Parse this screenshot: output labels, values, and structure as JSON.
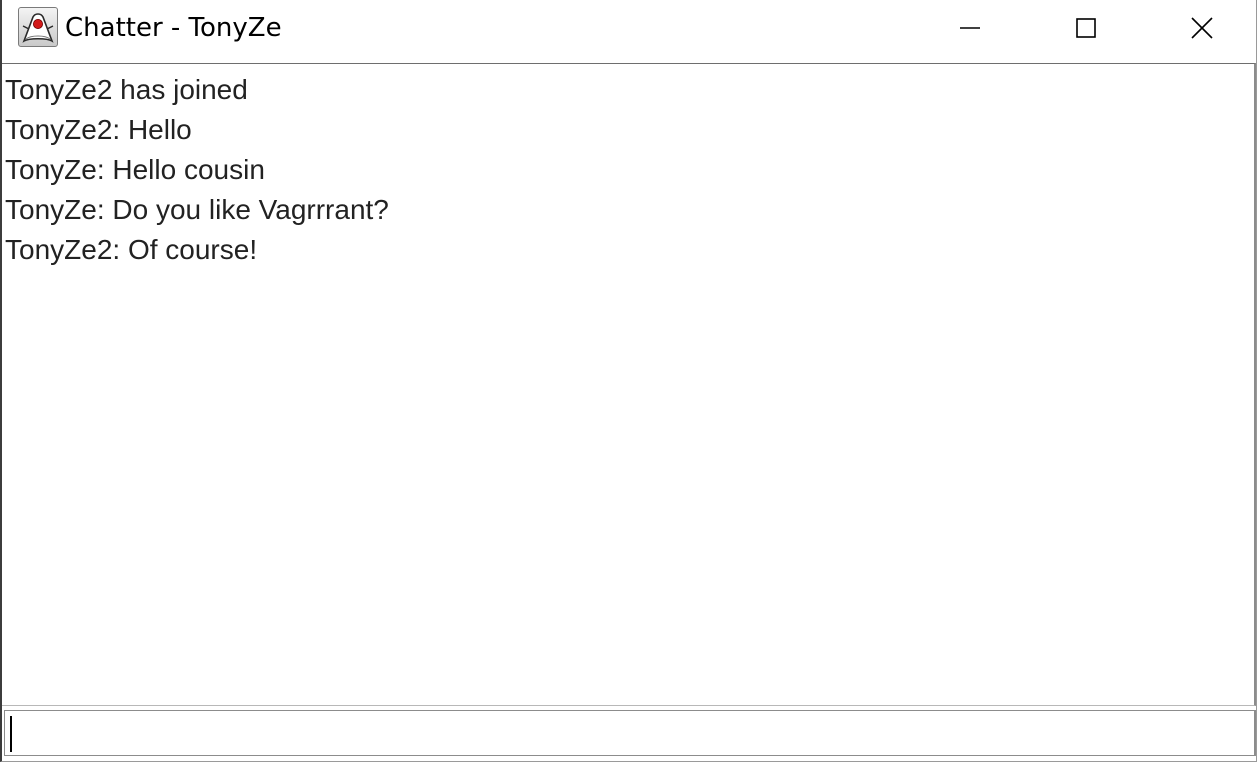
{
  "window": {
    "title": "Chatter - TonyZe",
    "app_icon": "java-duke-icon",
    "controls": {
      "minimize_icon": "minimize-icon",
      "maximize_icon": "maximize-icon",
      "close_icon": "close-icon"
    }
  },
  "chat": {
    "messages": [
      "TonyZe2 has joined",
      "TonyZe2: Hello",
      "TonyZe: Hello cousin",
      "TonyZe: Do you like Vagrrrant?",
      "TonyZe2: Of course!"
    ]
  },
  "input": {
    "value": "",
    "placeholder": ""
  }
}
